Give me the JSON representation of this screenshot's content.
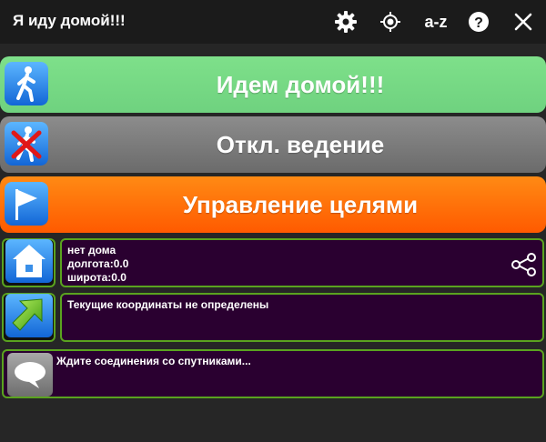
{
  "app": {
    "title": "Я иду домой!!!"
  },
  "toolbar": {
    "settings_icon": "gear-icon",
    "location_icon": "crosshair-icon",
    "sort_label": "a-z",
    "help_icon": "help-icon",
    "close_icon": "close-icon"
  },
  "buttons": {
    "go_home": {
      "label": "Идем домой!!!",
      "icon": "walking-man-icon",
      "color": "#7ee08a"
    },
    "disable_guidance": {
      "label": "Откл. ведение",
      "icon": "walking-man-crossed-icon",
      "color": "#7a7a7a"
    },
    "manage_targets": {
      "label": "Управление целями",
      "icon": "flag-icon",
      "color": "#ff6a00"
    }
  },
  "home_info": {
    "line1": "нет дома",
    "line2": "долгота:0.0",
    "line3": "широта:0.0",
    "icon": "home-icon",
    "share_icon": "share-icon"
  },
  "coords_info": {
    "text": "Текущие координаты не определены",
    "icon": "arrow-icon"
  },
  "satellite_info": {
    "text": "Ждите соединения со спутниками...",
    "icon": "speech-bubble-icon"
  },
  "colors": {
    "panel_border": "#5aa31f",
    "panel_bg": "#2a0030",
    "background": "#262626"
  }
}
